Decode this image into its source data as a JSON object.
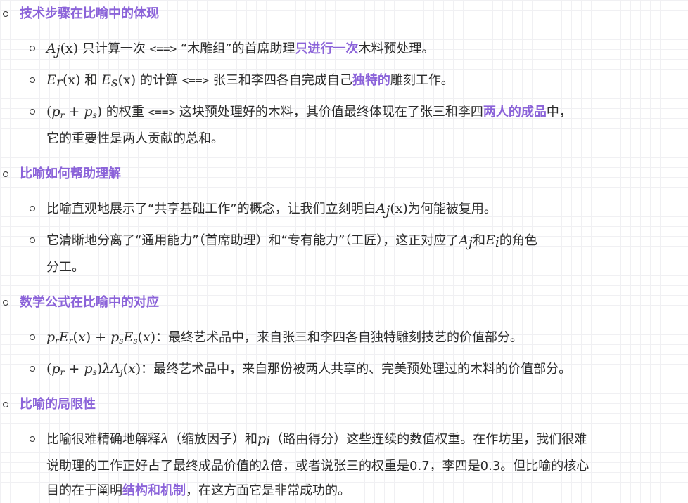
{
  "colors": {
    "accent": "#8b63d9",
    "text": "#2b2b2b",
    "grid": "#f0f0f3"
  },
  "sections": [
    {
      "title": "技术步骤在比喻中的体现",
      "items": [
        {
          "m_A": "A",
          "m_j": "j",
          "m_xA": "(x)",
          "t1": " 只计算一次 ",
          "code": "<==>",
          "t2": " “木雕组”的首席助理",
          "hl": "只进行一次",
          "t3": "木料预处理。"
        },
        {
          "m_E1": "E",
          "m_r": "r",
          "m_x1": "(x)",
          "and": " 和 ",
          "m_E2": "E",
          "m_s": "s",
          "m_x2": "(x)",
          "t1": " 的计算 ",
          "code": "<==>",
          "t2": " 张三和李四各自完成自己",
          "hl": "独特的",
          "t3": "雕刻工作。"
        },
        {
          "m_expr": "(p_r + p_s)",
          "t1": " 的权重 ",
          "code": "<==>",
          "t2": " 这块预处理好的木料，其价值最终体现在了张三和李四",
          "hl": "两人的成品",
          "t3": "中，",
          "t4": "它的重要性是两人贡献的总和。"
        }
      ]
    },
    {
      "title": "比喻如何帮助理解",
      "items": [
        {
          "t1": "比喻直观地展示了“共享基础工作”的概念，让我们立刻明白",
          "m_A": "A",
          "m_j": "j",
          "m_x": "(x)",
          "t2": "为何能被复用。"
        },
        {
          "t1": "它清晰地分离了“通用能力”（首席助理）和“专有能力”（工匠），这正对应了",
          "m_A": "A",
          "m_j": "j",
          "and": "和",
          "m_E": "E",
          "m_i": "i",
          "t2": "的角色",
          "t3": "分工。"
        }
      ]
    },
    {
      "title": "数学公式在比喻中的对应",
      "items": [
        {
          "formula": "p_r E_r(x) + p_s E_s(x)",
          "t1": "：最终艺术品中，来自张三和李四各自独特雕刻技艺的价值部分。"
        },
        {
          "formula": "(p_r + p_s) λ A_j(x)",
          "t1": "：最终艺术品中，来自那份被两人共享的、完美预处理过的木料的价值部分。"
        }
      ]
    },
    {
      "title": "比喻的局限性",
      "items": [
        {
          "t1": "比喻很难精确地解释",
          "lambda": "λ",
          "t2": "（缩放因子）和",
          "m_p": "p",
          "m_i": "i",
          "t3": "（路由得分）这些连续的数值权重。在作坊里，我们很难",
          "t4": "说助理的工作正好占了最终成品价值的",
          "lambda2": "λ",
          "t5": "倍，或者说张三的权重是0.7，李四是0.3。但比喻的核心",
          "t6": "目的在于阐明",
          "hl": "结构和机制",
          "t7": "，在这方面它是非常成功的。"
        }
      ]
    }
  ]
}
